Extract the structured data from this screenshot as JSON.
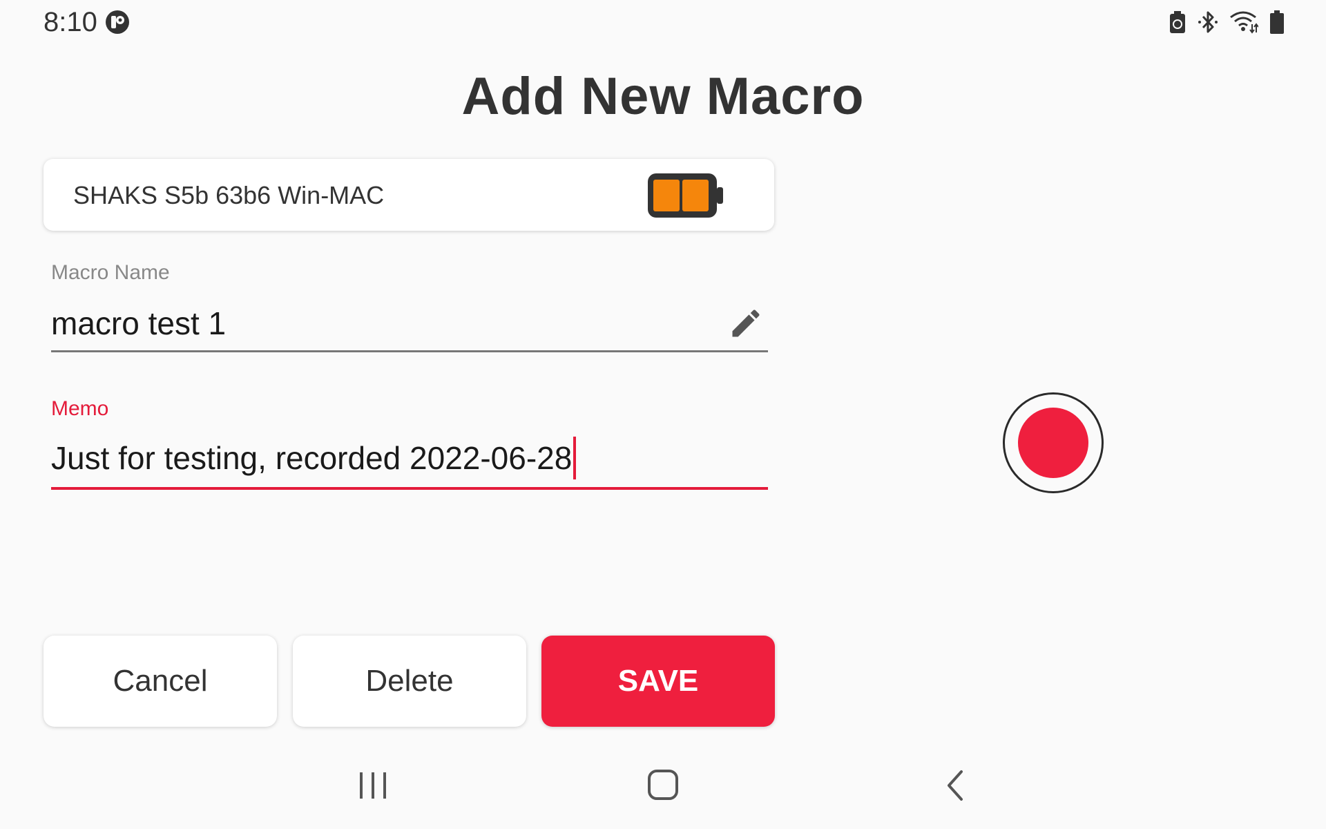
{
  "status_bar": {
    "time": "8:10",
    "left_icons": [
      "app-notification-icon"
    ],
    "right_icons": [
      "battery-saver-icon",
      "bluetooth-icon",
      "wifi-icon",
      "battery-icon"
    ]
  },
  "page": {
    "title": "Add New Macro"
  },
  "device": {
    "name": "SHAKS S5b 63b6 Win-MAC",
    "battery_level": 0.5,
    "battery_color": "#f5860c"
  },
  "form": {
    "macro_name_label": "Macro Name",
    "macro_name_value": "macro test 1",
    "memo_label": "Memo",
    "memo_value": "Just for testing, recorded 2022-06-28",
    "focused_field": "memo"
  },
  "buttons": {
    "cancel": "Cancel",
    "delete": "Delete",
    "save": "SAVE"
  },
  "nav": {
    "icons": [
      "recents-icon",
      "home-icon",
      "back-icon"
    ]
  },
  "colors": {
    "accent": "#ef1f3e",
    "background": "#fafafa"
  }
}
